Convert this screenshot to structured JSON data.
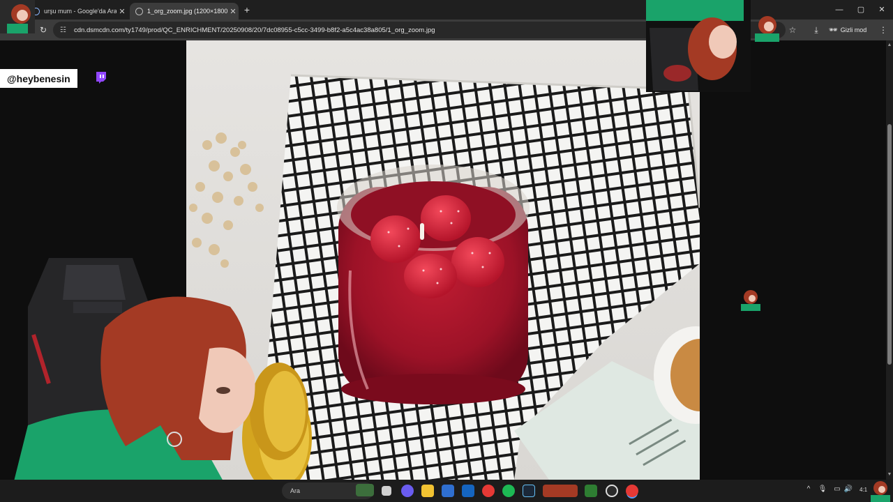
{
  "browser": {
    "tabs": [
      {
        "title": "urşu mum - Google'da Ara",
        "active": false
      },
      {
        "title": "1_org_zoom.jpg (1200×1800)",
        "active": true
      }
    ],
    "new_tab_icon": "plus-icon",
    "address": "cdn.dsmcdn.com/ty1749/prod/QC_ENRICHMENT/20250908/20/7dc08955-c5cc-3499-b8f2-a5c4ac38a805/1_org_zoom.jpg",
    "incognito_label": "Gizli mod",
    "window_controls": [
      "minimize-icon",
      "maximize-icon",
      "close-icon"
    ]
  },
  "overlay": {
    "handle": "@heybenesin",
    "platform_icon": "twitch-icon",
    "accent": "#9146ff"
  },
  "image": {
    "description_colors": {
      "wax": "#a3152a",
      "berry": "#d8223a",
      "cloth_line": "#111111",
      "lid": "#d4a51f"
    }
  },
  "taskbar": {
    "search_placeholder": "Ara",
    "clock_partial": "4:1"
  }
}
